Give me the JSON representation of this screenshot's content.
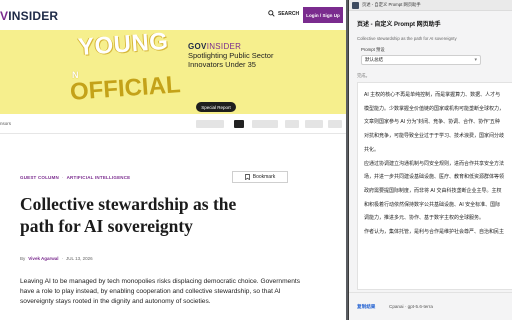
{
  "site": {
    "logo_prefix": "V",
    "logo_main": "INSIDER",
    "search_label": "SEARCH",
    "login_label": "Login / Sign Up"
  },
  "banner": {
    "young": "YOUNG",
    "nth": "N",
    "official": "OFFICIAL",
    "brand_gov": "GOV",
    "brand_insider": "INSIDER",
    "headline": "Spotlighting Public Sector Innovators Under 35",
    "cta": "Special Report"
  },
  "sponsors": {
    "label": "nsors"
  },
  "article": {
    "category_1": "GUEST COLUMN",
    "category_2": "ARTIFICIAL INTELLIGENCE",
    "bookmark_label": "Bookmark",
    "title": "Collective stewardship as the path for AI sovereignty",
    "by_prefix": "By",
    "author": "Vivek Agarwal",
    "date": "JUL 13, 2026",
    "body": "Leaving AI to be managed by tech monopolies risks displacing democratic choice. Governments have a role to play instead, by enabling cooperation and collective stewardship, so that AI sovereignty stays rooted in the dignity and autonomy of societies."
  },
  "panel": {
    "window_title": "页述 - 自定义 Prompt 网页助手",
    "title": "页述 - 自定义 Prompt 网页助手",
    "url": "Collective stewardship as the path for AI sovereignty",
    "prompt_label": "Prompt 预设",
    "prompt_value": "默认总结",
    "status": "完成。",
    "output": [
      "AI 主权的核心不再是单纯控制，而是掌握算力、数据、人才与",
      "模型能力。少数掌握全价值链的国家或机构可能垄断全球权力，",
      "文章则国家参与 AI 分为“封闭、竞争、协调、合作、协作”五种",
      "对抗和竞争，可能导致全业过于于学习、技术浪费，国家间分歧",
      "共化。",
      "应通过协调建立沟通机制与同安全规则，进而合作共享安全方法",
      "场，并进一步共同建设基础设施、医疗、教育和低资源群体等领",
      "政府需要提国际制度，而非将 AI 交由科技垄断企业主导。主权",
      "和积极着行动依然保持数字公共基础设施、AI 安全标准、国际",
      "调能力，推进多元、协作、基于数字主权的全球服务。",
      "作者认为，集体托管，是利与合作是维护社会尊严、自治和民主"
    ],
    "copy_label": "复制结果",
    "model": "Cpanai · gpt-5.6-terra"
  },
  "colors": {
    "brand_purple": "#7a2b8e",
    "banner_yellow": "#f6ef8d",
    "link_blue": "#1f5fd1"
  }
}
